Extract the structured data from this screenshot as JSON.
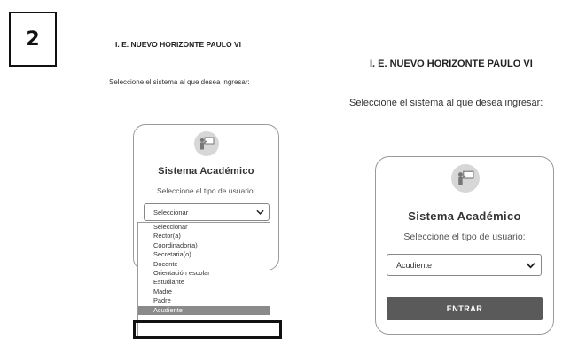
{
  "step": {
    "number": "2"
  },
  "left_panel": {
    "school_title": "I. E. NUEVO HORIZONTE PAULO VI",
    "prompt": "Seleccione el sistema al que desea ingresar:",
    "card": {
      "title": "Sistema Académico",
      "subtitle": "Seleccione el tipo de usuario:",
      "select_value": "Seleccionar",
      "options": [
        "Seleccionar",
        "Rector(a)",
        "Coordinador(a)",
        "Secretaria(o)",
        "Docente",
        "Orientación escolar",
        "Estudiante",
        "Madre",
        "Padre",
        "Acudiente"
      ],
      "selected_option": "Acudiente"
    }
  },
  "right_panel": {
    "school_title": "I. E. NUEVO HORIZONTE PAULO VI",
    "prompt": "Seleccione el sistema al que desea ingresar:",
    "card": {
      "title": "Sistema Académico",
      "subtitle": "Seleccione el tipo de usuario:",
      "select_value": "Acudiente",
      "enter_label": "ENTRAR"
    }
  },
  "icons": {
    "logo": "teacher-board-icon",
    "dropdown_arrow": "chevron-down-icon"
  },
  "colors": {
    "logo_bg": "#d7d7d7",
    "enter_button": "#5a5a5a",
    "selected_option_bg": "#8a8a8a"
  }
}
